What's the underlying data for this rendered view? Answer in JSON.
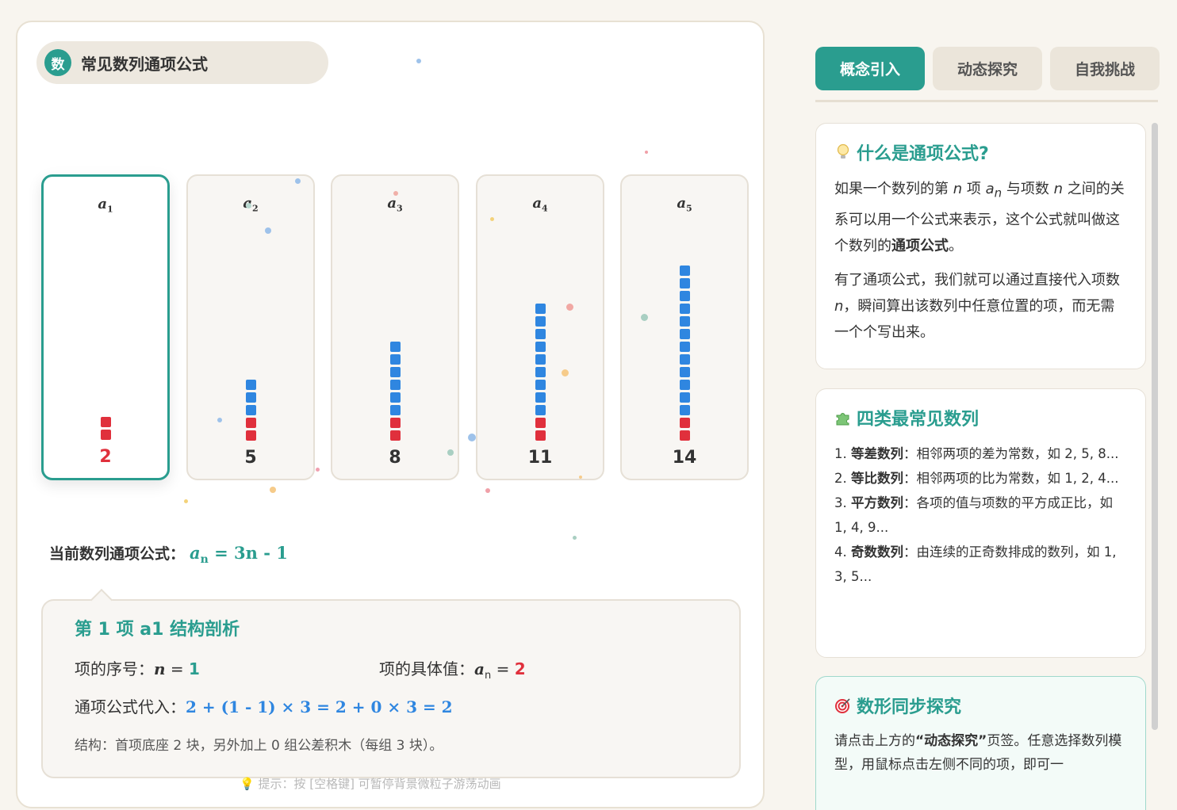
{
  "header": {
    "badge": "数",
    "title": "常见数列通项公式"
  },
  "sequence": {
    "terms": [
      {
        "label": "a",
        "index": "1",
        "value": "2",
        "value_num": 2,
        "red_blocks": 2,
        "blue_blocks": 0,
        "active": true
      },
      {
        "label": "a",
        "index": "2",
        "value": "5",
        "value_num": 5,
        "red_blocks": 2,
        "blue_blocks": 3,
        "active": false
      },
      {
        "label": "a",
        "index": "3",
        "value": "8",
        "value_num": 8,
        "red_blocks": 2,
        "blue_blocks": 6,
        "active": false
      },
      {
        "label": "a",
        "index": "4",
        "value": "11",
        "value_num": 11,
        "red_blocks": 2,
        "blue_blocks": 9,
        "active": false
      },
      {
        "label": "a",
        "index": "5",
        "value": "14",
        "value_num": 14,
        "red_blocks": 2,
        "blue_blocks": 12,
        "active": false
      }
    ]
  },
  "formula": {
    "label": "当前数列通项公式：",
    "lhs": "a",
    "lhs_sub": "n",
    "rhs": " = 3n - 1"
  },
  "analysis": {
    "title": "第 1 项 a1 结构剖析",
    "index_label": "项的序号：",
    "index_var": "n",
    "index_eq": " = ",
    "index_value": "1",
    "value_label": "项的具体值：",
    "value_var": "a",
    "value_sub": "n",
    "value_eq": " = ",
    "value_value": "2",
    "sub_label": "通项公式代入：",
    "sub_expr": "2 + (1 - 1) × 3 = 2 + 0 × 3 = 2",
    "structure": "结构：首项底座 2 块，另外加上 0 组公差积木（每组 3 块）。"
  },
  "hint": "💡 提示：按 [空格键] 可暂停背景微粒子游荡动画",
  "tabs": [
    {
      "label": "概念引入",
      "active": true
    },
    {
      "label": "动态探究",
      "active": false
    },
    {
      "label": "自我挑战",
      "active": false
    }
  ],
  "cards": {
    "what": {
      "icon": "lightbulb-icon",
      "title": "什么是通项公式?",
      "p1_a": "如果一个数列的第 ",
      "p1_n": "n",
      "p1_b": " 项 ",
      "p1_an": "a",
      "p1_an_sub": "n",
      "p1_c": " 与项数 ",
      "p1_n2": "n",
      "p1_d": " 之间的关系可以用一个公式来表示，这个公式就叫做这个数列的",
      "p1_bold": "通项公式",
      "p1_e": "。",
      "p2_a": "有了通项公式，我们就可以通过直接代入项数 ",
      "p2_n": "n",
      "p2_b": "，瞬间算出该数列中任意位置的项，而无需一个个写出来。"
    },
    "types": {
      "icon": "puzzle-icon",
      "title": "四类最常见数列",
      "items": [
        {
          "num": "1. ",
          "name": "等差数列",
          "desc": "：相邻两项的差为常数，如 2, 5, 8..."
        },
        {
          "num": "2. ",
          "name": "等比数列",
          "desc": "：相邻两项的比为常数，如 1, 2, 4..."
        },
        {
          "num": "3. ",
          "name": "平方数列",
          "desc": "：各项的值与项数的平方成正比，如 1, 4, 9..."
        },
        {
          "num": "4. ",
          "name": "奇数数列",
          "desc": "：由连续的正奇数排成的数列，如 1, 3, 5..."
        }
      ]
    },
    "explore": {
      "icon": "target-icon",
      "title": "数形同步探究",
      "p_a": "请点击上方的",
      "p_bold": "“动态探究”",
      "p_b": "页签。任意选择数列模型，用鼠标点击左侧不同的项，即可一"
    }
  },
  "colors": {
    "accent": "#2a9d8f",
    "red": "#e0303c",
    "blue": "#2f86e0"
  }
}
